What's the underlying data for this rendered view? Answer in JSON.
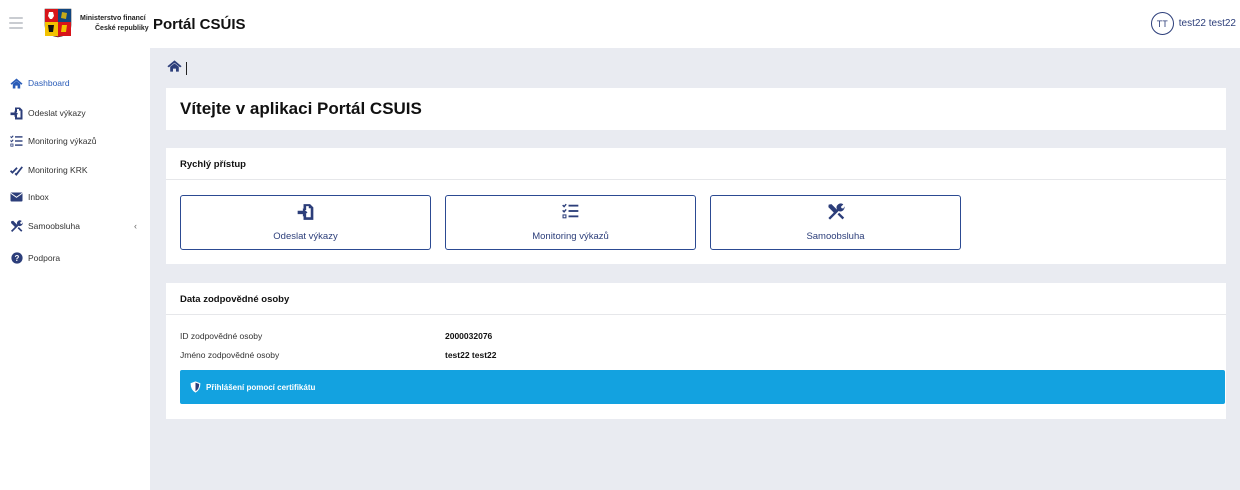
{
  "header": {
    "ministry_line1": "Ministerstvo financí",
    "ministry_line2": "České republiky",
    "app_title": "Portál CSÚIS",
    "user_initials": "TT",
    "user_name": "test22 test22"
  },
  "sidebar": {
    "items": [
      {
        "label": "Dashboard",
        "icon": "home-icon",
        "active": true
      },
      {
        "label": "Odeslat výkazy",
        "icon": "file-import-icon"
      },
      {
        "label": "Monitoring výkazů",
        "icon": "list-check-icon"
      },
      {
        "label": "Monitoring KRK",
        "icon": "double-check-icon"
      },
      {
        "label": "Inbox",
        "icon": "envelope-icon"
      },
      {
        "label": "Samoobsluha",
        "icon": "tools-icon",
        "expandable": true
      },
      {
        "label": "Podpora",
        "icon": "question-circle-icon"
      }
    ]
  },
  "main": {
    "welcome_title": "Vítejte v aplikaci Portál CSUIS",
    "quick_access": {
      "title": "Rychlý přístup",
      "tiles": [
        {
          "label": "Odeslat výkazy",
          "icon": "file-import-icon"
        },
        {
          "label": "Monitoring výkazů",
          "icon": "list-check-icon"
        },
        {
          "label": "Samoobsluha",
          "icon": "tools-icon"
        }
      ]
    },
    "responsible_person": {
      "title": "Data zodpovědné osoby",
      "id_label": "ID zodpovědné osoby",
      "id_value": "2000032076",
      "name_label": "Jméno zodpovědné osoby",
      "name_value": "test22 test22",
      "cert_label": "Přihlášení pomocí certifikátu"
    }
  },
  "colors": {
    "primary": "#2c3e7a",
    "active_link": "#2a5cb8",
    "main_bg": "#e9ebf1",
    "cert_bar": "#13a2e0"
  }
}
